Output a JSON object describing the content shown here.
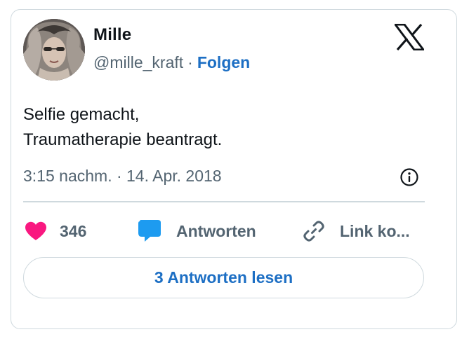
{
  "author": {
    "name": "Mille",
    "handle": "@mille_kraft",
    "separator": "·",
    "follow_label": "Folgen"
  },
  "tweet": {
    "lines": [
      "Selfie gemacht,",
      "Traumatherapie beantragt."
    ],
    "timestamp": "3:15 nachm. · 14. Apr. 2018"
  },
  "actions": {
    "like_count": "346",
    "reply_label": "Antworten",
    "copy_link_label": "Link ko..."
  },
  "read_replies_label": "3 Antworten lesen",
  "icons": {
    "brand": "x-logo-icon",
    "info": "info-icon",
    "like": "heart-icon",
    "reply": "speech-bubble-icon",
    "copy": "link-icon"
  },
  "colors": {
    "heart": "#f91880",
    "bubble": "#1d9bf0",
    "link_blue": "#1d6fc4",
    "muted": "#536471",
    "border": "#cfd9de"
  }
}
